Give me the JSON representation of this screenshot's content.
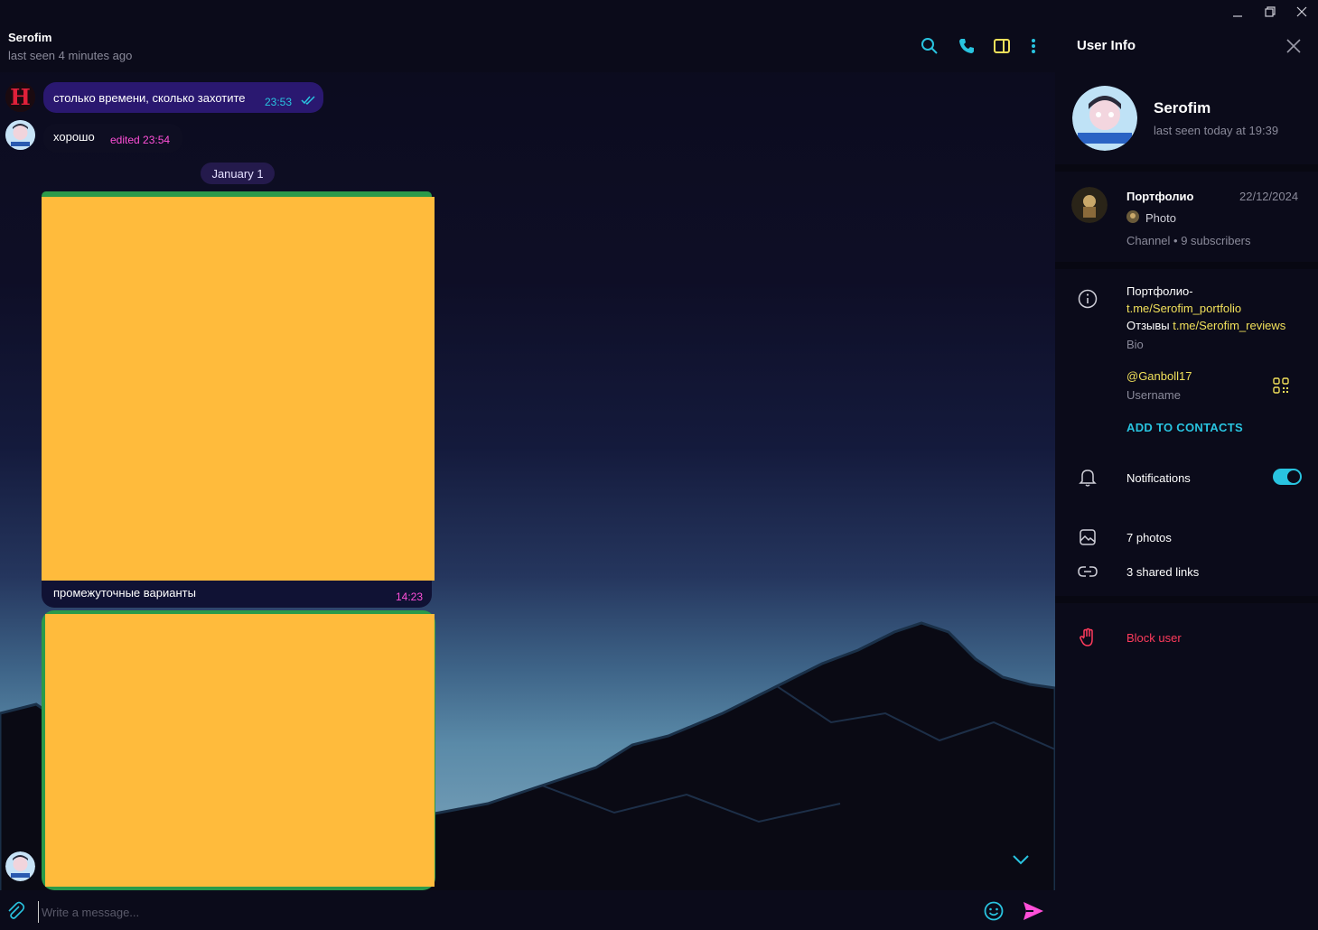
{
  "window": {
    "minimize_icon": "minimize-icon",
    "restore_icon": "restore-icon",
    "close_icon": "close-icon"
  },
  "chat": {
    "title": "Serofim",
    "status": "last seen 4 minutes ago",
    "messages": [
      {
        "text": "столько времени, сколько захотите",
        "time": "23:53",
        "read": true
      },
      {
        "text": "хорошо",
        "time": "edited 23:54"
      }
    ],
    "date_separator": "January 1",
    "photo_caption": "промежуточные варианты",
    "photo_time": "14:23",
    "input_placeholder": "Write a message..."
  },
  "panel": {
    "header": "User Info",
    "name": "Serofim",
    "last_seen": "last seen today at 19:39",
    "channel": {
      "name": "Портфолио",
      "date": "22/12/2024",
      "preview": "Photo",
      "meta": "Channel • 9 subscribers"
    },
    "bio": {
      "line1": "Портфолио-",
      "link1": "t.me/Serofim_portfolio",
      "line3_prefix": "Отзывы ",
      "link2": "t.me/Serofim_reviews",
      "label": "Bio"
    },
    "username": {
      "value": "@Ganboll17",
      "label": "Username"
    },
    "add_contacts": "ADD TO CONTACTS",
    "notifications": {
      "label": "Notifications",
      "enabled": true
    },
    "photos": "7 photos",
    "links": "3 shared links",
    "block": "Block user"
  },
  "colors": {
    "accent": "#29c4e0",
    "yellow": "#f1e05a",
    "magenta": "#ff4fd8",
    "danger": "#ff3b5c",
    "photo_placeholder": "#ffbb3c"
  }
}
